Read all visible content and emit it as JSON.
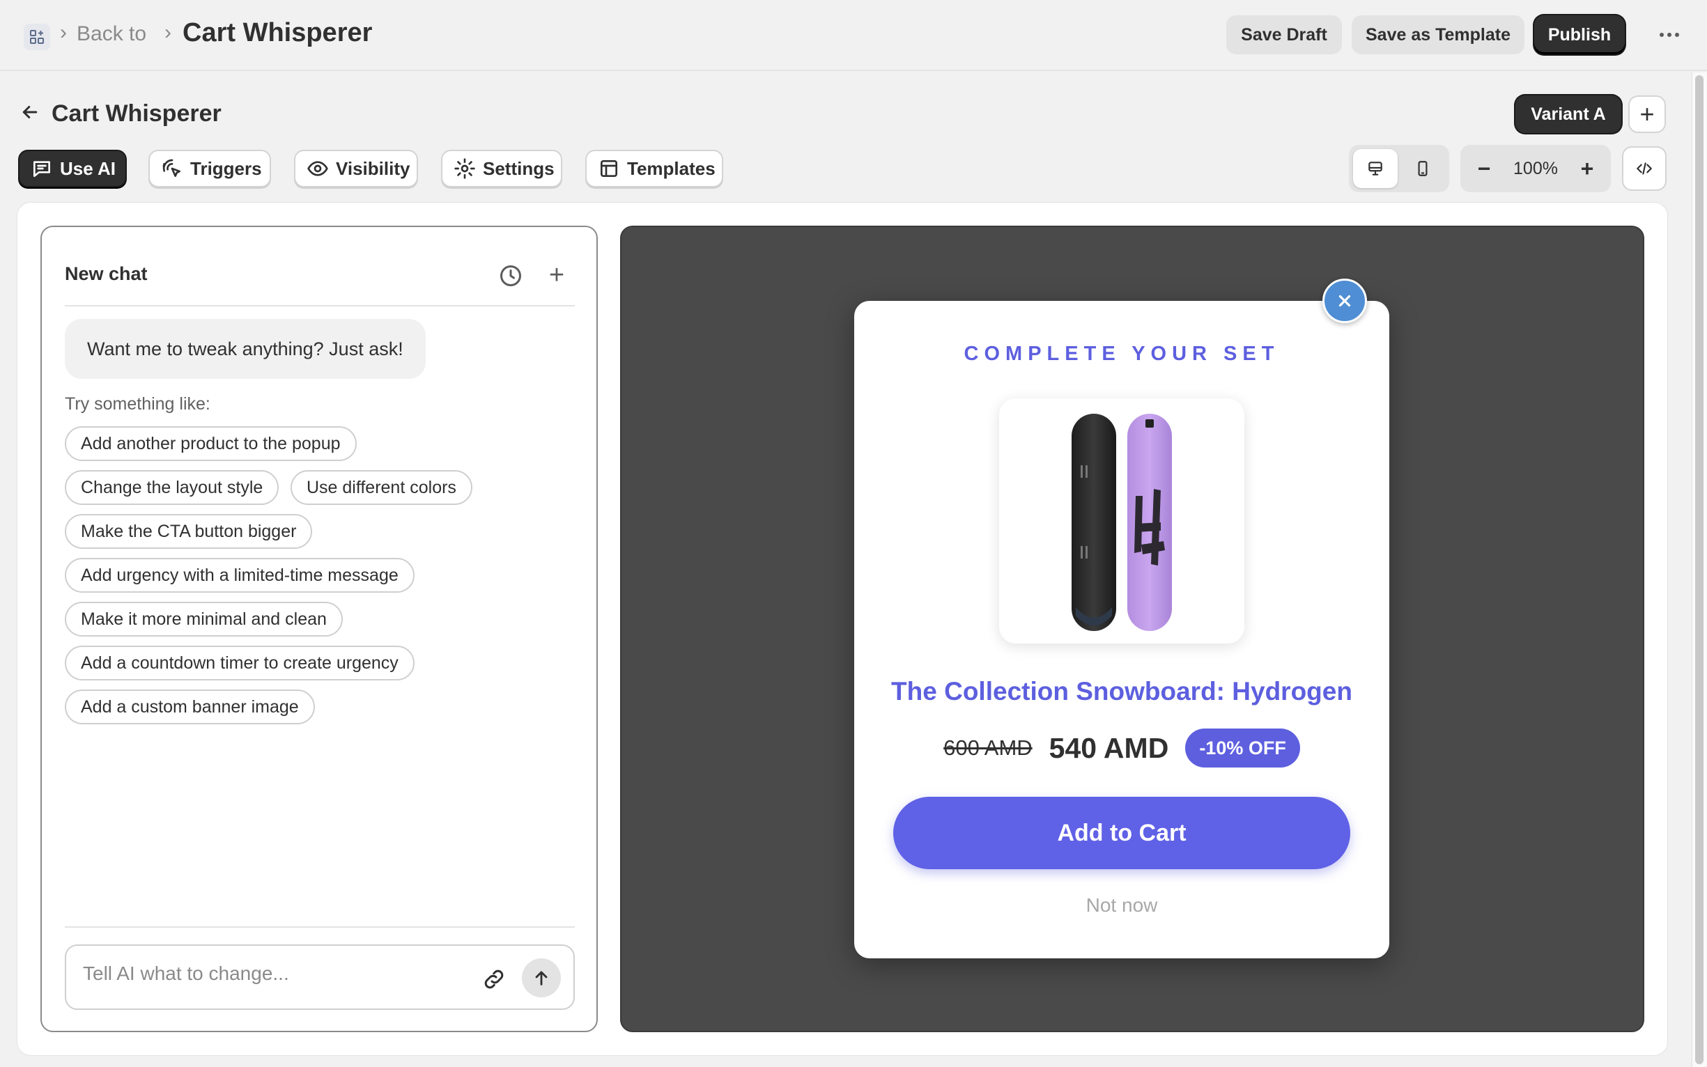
{
  "topbar": {
    "app_icon": "apps-grid-icon",
    "back_label": "Back to",
    "app_title": "Cart Whisperer",
    "save_draft": "Save Draft",
    "save_template": "Save as Template",
    "publish": "Publish",
    "more_icon": "more-horizontal-icon"
  },
  "header": {
    "title": "Cart Whisperer",
    "variant": "Variant A"
  },
  "toolbar": {
    "tabs": [
      {
        "label": "Use AI",
        "icon": "chat-icon",
        "active": true
      },
      {
        "label": "Triggers",
        "icon": "cursor-click-icon",
        "active": false
      },
      {
        "label": "Visibility",
        "icon": "eye-icon",
        "active": false
      },
      {
        "label": "Settings",
        "icon": "gear-icon",
        "active": false
      },
      {
        "label": "Templates",
        "icon": "layout-icon",
        "active": false
      }
    ],
    "device": "desktop",
    "zoom": "100%"
  },
  "chat": {
    "title": "New chat",
    "ai_message": "Want me to tweak anything? Just ask!",
    "try_label": "Try something like:",
    "suggestions": [
      "Add another product to the popup",
      "Change the layout style",
      "Use different colors",
      "Make the CTA button bigger",
      "Add urgency with a limited-time message",
      "Make it more minimal and clean",
      "Add a countdown timer to create urgency",
      "Add a custom banner image"
    ],
    "input_placeholder": "Tell AI what to change..."
  },
  "popup": {
    "kicker": "COMPLETE YOUR SET",
    "product_name": "The Collection Snowboard: Hydrogen",
    "old_price": "600 AMD",
    "new_price": "540 AMD",
    "discount": "-10% OFF",
    "cta": "Add to Cart",
    "dismiss": "Not now",
    "accent_color": "#5d5fdf",
    "close_color": "#4f8ed4"
  }
}
